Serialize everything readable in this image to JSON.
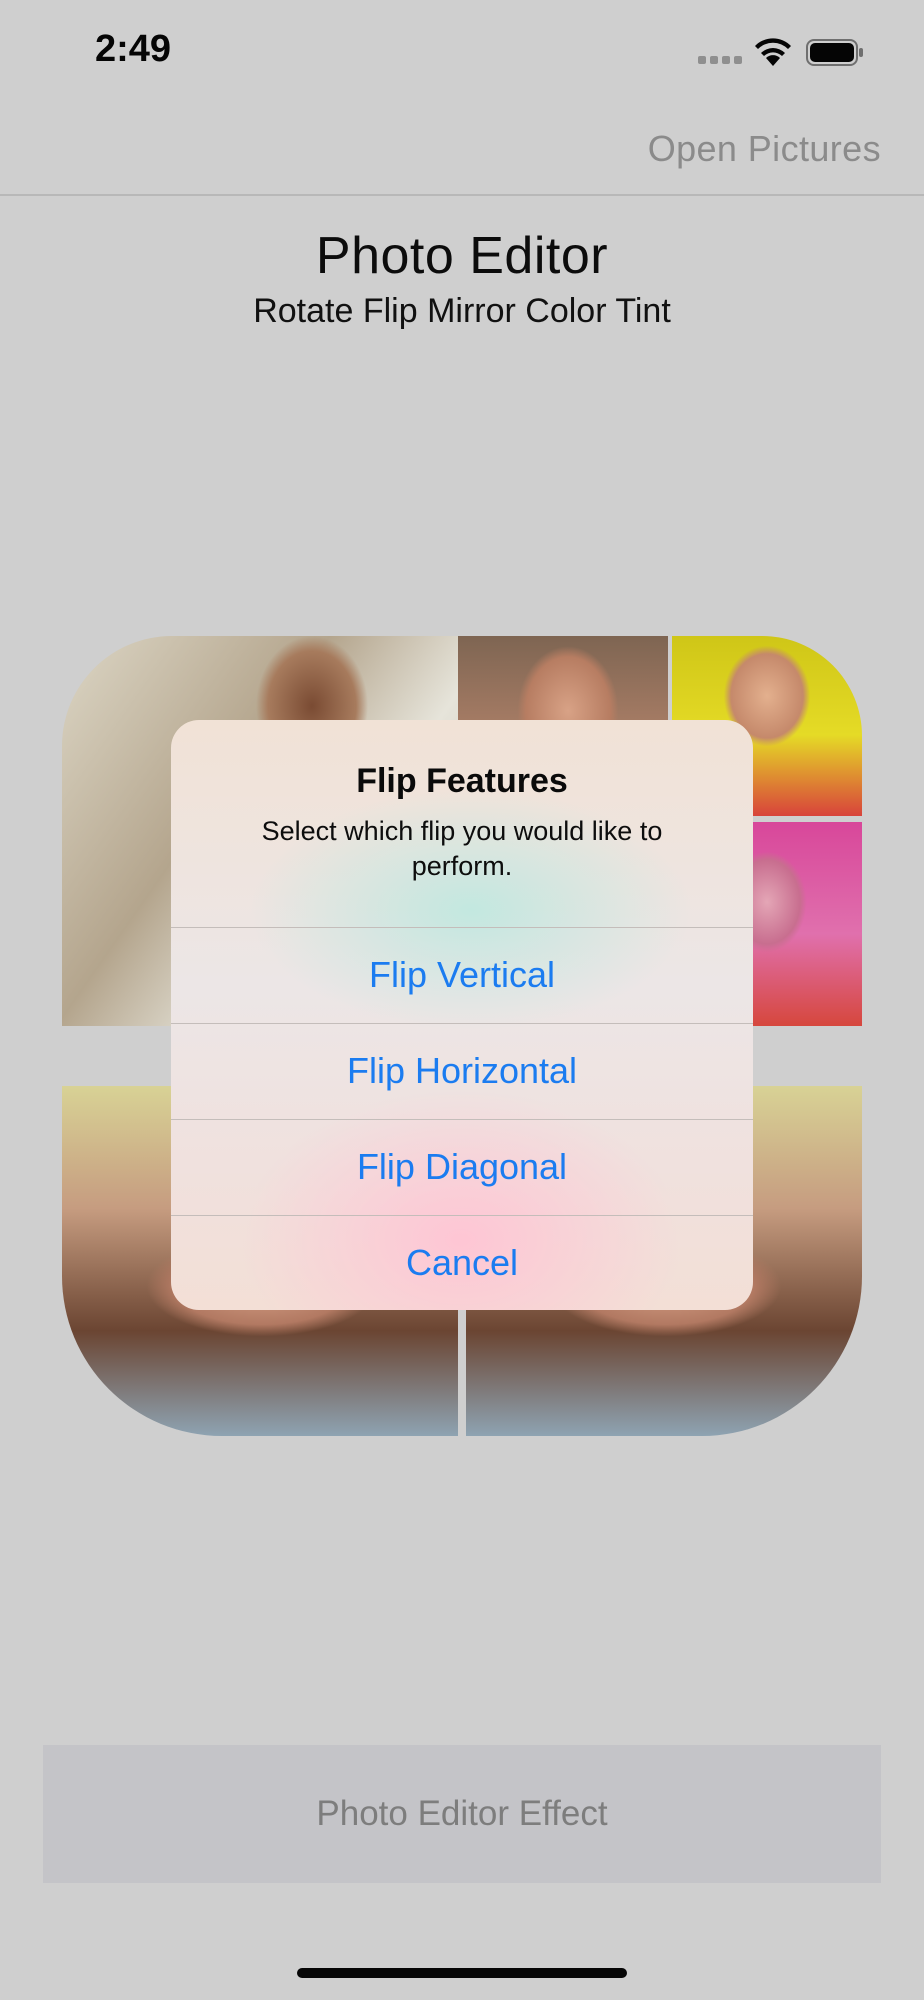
{
  "status_bar": {
    "time": "2:49"
  },
  "nav": {
    "open_pictures_label": "Open Pictures"
  },
  "header": {
    "title": "Photo  Editor",
    "subtitle": "Rotate Flip Mirror Color Tint"
  },
  "alert": {
    "title": "Flip Features",
    "message": "Select which flip you would like to perform.",
    "actions": [
      {
        "label": "Flip Vertical"
      },
      {
        "label": "Flip Horizontal"
      },
      {
        "label": "Flip Diagonal"
      },
      {
        "label": "Cancel"
      }
    ],
    "action_color": "#1b7cf0"
  },
  "footer": {
    "effect_button_label": "Photo Editor Effect"
  },
  "icons": [
    "signal-icon",
    "wifi-icon",
    "battery-icon"
  ]
}
